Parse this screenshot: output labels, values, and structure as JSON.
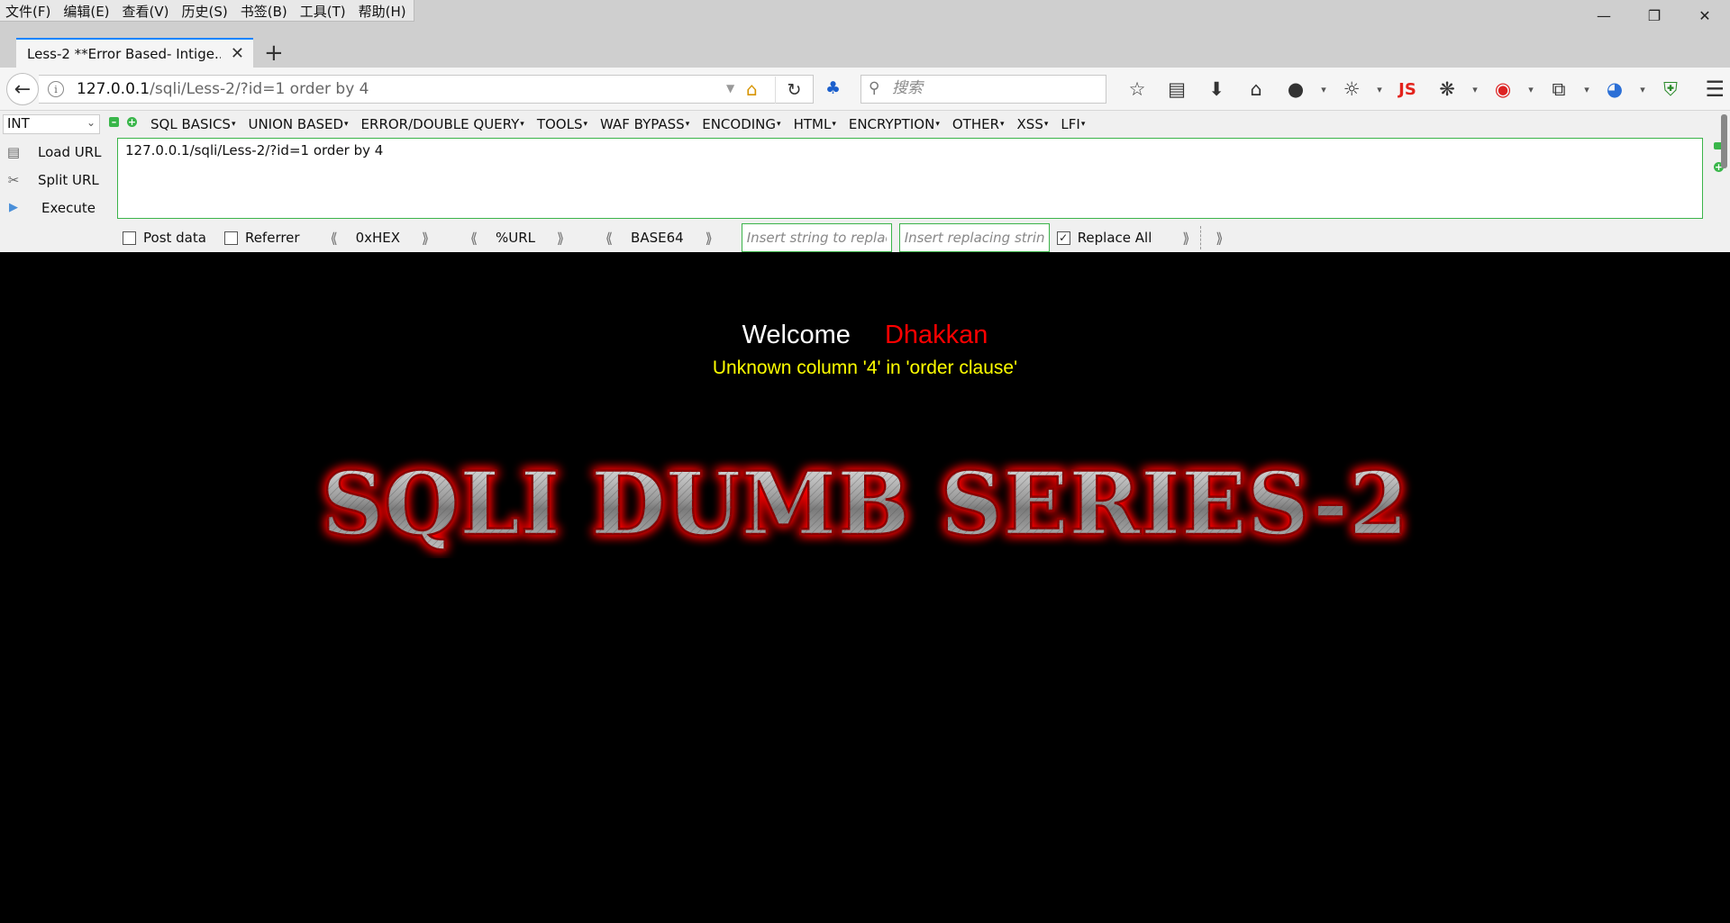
{
  "menu": [
    "文件(F)",
    "编辑(E)",
    "查看(V)",
    "历史(S)",
    "书签(B)",
    "工具(T)",
    "帮助(H)"
  ],
  "window_controls": {
    "minimize": "—",
    "restore": "❐",
    "close": "✕"
  },
  "tab": {
    "title": "Less-2 **Error Based- Intige...",
    "close": "✕",
    "new_tab": "+"
  },
  "url": {
    "host": "127.0.0.1",
    "path": "/sqli/Less-2/?id=1 order by 4"
  },
  "search": {
    "placeholder": "搜索"
  },
  "toolbar": {
    "js_label": "JS"
  },
  "hackbar": {
    "select_value": "INT",
    "menus": [
      "SQL BASICS",
      "UNION BASED",
      "ERROR/DOUBLE QUERY",
      "TOOLS",
      "WAF BYPASS",
      "ENCODING",
      "HTML",
      "ENCRYPTION",
      "OTHER",
      "XSS",
      "LFI"
    ],
    "load_url": "Load URL",
    "split_url": "Split URL",
    "execute": "Execute",
    "textarea_value": "127.0.0.1/sqli/Less-2/?id=1 order by 4",
    "post_data": "Post data",
    "referrer": "Referrer",
    "hex": "0xHEX",
    "url_enc": "%URL",
    "base64": "BASE64",
    "replace_placeholder": "Insert string to replace",
    "replacing_placeholder": "Insert replacing string",
    "replace_all": "Replace All",
    "replace_all_checked": true
  },
  "page": {
    "welcome": "Welcome",
    "username": "Dhakkan",
    "error": "Unknown column '4' in 'order clause'",
    "banner": "SQLI DUMB SERIES-2"
  },
  "colors": {
    "page_bg": "#000000",
    "welcome": "#ffffff",
    "username": "#ff0000",
    "error": "#ffff00",
    "banner_glow": "#ff0000",
    "accent": "#3bb44a"
  }
}
